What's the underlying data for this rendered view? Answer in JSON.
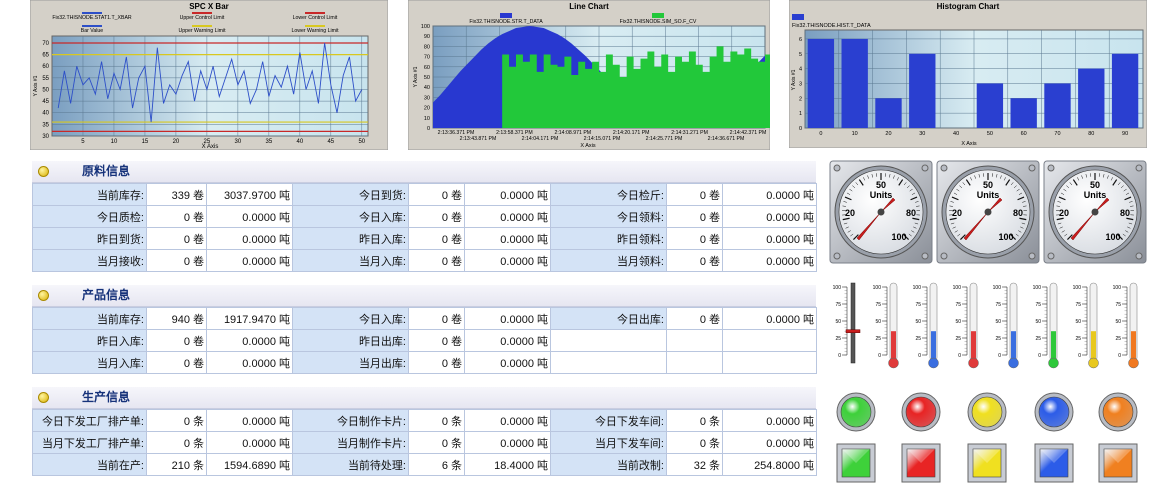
{
  "spc_chart": {
    "title": "SPC X Bar",
    "legend": [
      {
        "label": "Fix32.THISNODE.STAT1.T_XBAR",
        "color": "#2d4fc8"
      },
      {
        "label": "Upper Control Limit",
        "color": "#c82828"
      },
      {
        "label": "Lower Control Limit",
        "color": "#c82828"
      },
      {
        "label": "Bar Value",
        "color": "#2d4fc8"
      },
      {
        "label": "Upper Warning Limit",
        "color": "#d8c820"
      },
      {
        "label": "Lower Warning Limit",
        "color": "#d8c820"
      }
    ],
    "ylabel": "Y Axis #1",
    "xlabel": "X Axis",
    "y_ticks": [
      "70",
      "65",
      "60",
      "55",
      "50",
      "45",
      "40",
      "35",
      "30"
    ],
    "x_ticks": [
      "5",
      "10",
      "15",
      "20",
      "25",
      "30",
      "35",
      "40",
      "45",
      "50"
    ]
  },
  "line_chart": {
    "title": "Line Chart",
    "legend": [
      {
        "label": "Fix32.THISNODE.STR.T_DATA",
        "color": "#2838d0"
      },
      {
        "label": "Fix32.THISNODE.SIM_SO.F_CV",
        "color": "#22c83a"
      }
    ],
    "ylabel": "Y Axis #1",
    "xlabel": "X Axis",
    "y_ticks": [
      "100",
      "90",
      "80",
      "70",
      "60",
      "50",
      "40",
      "30",
      "20",
      "10",
      "0"
    ],
    "x_ticks_top": [
      "2:13:36.371 PM",
      "2:13:58.371 PM",
      "2:14:08.971 PM",
      "2:14:20.171 PM",
      "2:14:31.271 PM",
      "2:14:42.371 PM"
    ],
    "x_ticks_bottom": [
      "2:13:43.871 PM",
      "2:14:04.171 PM",
      "2:14:15.071 PM",
      "2:14:25.771 PM",
      "2:14:36.671 PM"
    ]
  },
  "histogram_chart": {
    "title": "Histogram Chart",
    "legend": [
      {
        "label": "Fix32.THISNODE.HIST.T_DATA",
        "color": "#2a3fd0"
      }
    ],
    "ylabel": "Y Axis #1",
    "xlabel": "X Axis",
    "y_ticks": [
      "6",
      "5",
      "4",
      "3",
      "2",
      "1",
      "0"
    ],
    "x_ticks": [
      "0",
      "10",
      "20",
      "30",
      "40",
      "50",
      "60",
      "70",
      "80",
      "90"
    ]
  },
  "chart_data": [
    {
      "type": "line",
      "title": "SPC X Bar",
      "xlabel": "X Axis",
      "ylabel": "Y Axis #1",
      "xlim": [
        0,
        51
      ],
      "ylim": [
        30,
        73
      ],
      "reference_lines": {
        "upper_control": 70,
        "lower_control": 32,
        "upper_warning": 65,
        "lower_warning": 36
      },
      "series": [
        {
          "name": "Fix32.THISNODE.STAT1.T_XBAR",
          "x": [
            1,
            2,
            3,
            4,
            5,
            6,
            7,
            8,
            9,
            10,
            11,
            12,
            13,
            14,
            15,
            16,
            17,
            18,
            19,
            20,
            21,
            22,
            23,
            24,
            25,
            26,
            27,
            28,
            29,
            30,
            31,
            32,
            33,
            34,
            35,
            36,
            37,
            38,
            39,
            40,
            41,
            42,
            43,
            44,
            45,
            46,
            47,
            48,
            49,
            50
          ],
          "y": [
            42,
            58,
            44,
            60,
            52,
            55,
            48,
            62,
            46,
            57,
            50,
            64,
            42,
            55,
            60,
            36,
            68,
            44,
            52,
            48,
            56,
            62,
            45,
            58,
            50,
            60,
            47,
            55,
            63,
            52,
            58,
            44,
            50,
            62,
            47,
            56,
            51,
            60,
            48,
            66,
            50,
            58,
            44,
            70,
            52,
            40,
            56,
            64,
            45,
            50
          ]
        }
      ]
    },
    {
      "type": "area",
      "title": "Line Chart",
      "xlabel": "X Axis",
      "ylabel": "Y Axis #1",
      "ylim": [
        0,
        100
      ],
      "series": [
        {
          "name": "Fix32.THISNODE.STR.T_DATA",
          "x": [
            0,
            1,
            2,
            3,
            4,
            5,
            6,
            7,
            8,
            9,
            10,
            11,
            12,
            13,
            14,
            15,
            16,
            17,
            18,
            19,
            20,
            21,
            22,
            23,
            24,
            25,
            26,
            27,
            28,
            29,
            30,
            31,
            32,
            33,
            34,
            35,
            36,
            37,
            38,
            39,
            40,
            41,
            42,
            43,
            44,
            45,
            46,
            47,
            48
          ],
          "y": [
            25,
            32,
            40,
            48,
            56,
            63,
            70,
            77,
            83,
            88,
            92,
            95,
            98,
            99,
            100,
            99,
            98,
            95,
            92,
            88,
            83,
            77,
            71,
            64,
            57,
            50,
            43,
            36,
            29,
            23,
            17,
            12,
            8,
            5,
            3,
            2,
            3,
            5,
            8,
            12,
            17,
            23,
            29,
            36,
            43,
            50,
            57,
            64,
            71
          ]
        },
        {
          "name": "Fix32.THISNODE.SIM_SO.F_CV",
          "x": [
            10,
            11,
            12,
            13,
            14,
            15,
            16,
            17,
            18,
            19,
            20,
            21,
            22,
            23,
            24,
            25,
            26,
            27,
            28,
            29,
            30,
            31,
            32,
            33,
            34,
            35,
            36,
            37,
            38,
            39,
            40,
            41,
            42,
            43,
            44,
            45,
            46,
            47,
            48
          ],
          "y": [
            72,
            60,
            72,
            65,
            72,
            55,
            72,
            62,
            60,
            70,
            52,
            65,
            58,
            65,
            55,
            72,
            62,
            50,
            70,
            58,
            68,
            75,
            60,
            72,
            55,
            70,
            65,
            75,
            62,
            55,
            70,
            80,
            65,
            75,
            72,
            78,
            68,
            65,
            72
          ]
        }
      ]
    },
    {
      "type": "bar",
      "title": "Histogram Chart",
      "xlabel": "X Axis",
      "ylabel": "Y Axis #1",
      "ylim": [
        0,
        6.6
      ],
      "categories": [
        "0",
        "10",
        "20",
        "30",
        "40",
        "50",
        "60",
        "70",
        "80",
        "90"
      ],
      "series": [
        {
          "name": "Fix32.THISNODE.HIST.T_DATA",
          "values": [
            6,
            6,
            2,
            5,
            0,
            3,
            2,
            3,
            4,
            5
          ]
        }
      ]
    }
  ],
  "gauges": [
    {
      "value_label": "50",
      "units": "Units",
      "tick_left": "20",
      "tick_right": "80",
      "tick_bottom": "100"
    },
    {
      "value_label": "50",
      "units": "Units",
      "tick_left": "20",
      "tick_right": "80",
      "tick_bottom": "100"
    },
    {
      "value_label": "50",
      "units": "Units",
      "tick_left": "20",
      "tick_right": "80",
      "tick_bottom": "100"
    }
  ],
  "thermometers": {
    "ticks": [
      "100",
      "75",
      "50",
      "25",
      "0"
    ],
    "items": [
      {
        "kind": "slider",
        "level": 0.35,
        "color": "#c81e1e"
      },
      {
        "kind": "tube",
        "level": 0.35,
        "color": "#e03a3a"
      },
      {
        "kind": "tube",
        "level": 0.35,
        "color": "#3a6ee0"
      },
      {
        "kind": "tube",
        "level": 0.35,
        "color": "#e03a3a"
      },
      {
        "kind": "tube",
        "level": 0.35,
        "color": "#3a6ee0"
      },
      {
        "kind": "tube",
        "level": 0.35,
        "color": "#2ec83a"
      },
      {
        "kind": "tube",
        "level": 0.35,
        "color": "#e8c81e"
      },
      {
        "kind": "tube",
        "level": 0.35,
        "color": "#f07820"
      }
    ]
  },
  "lights": {
    "round": [
      "#3ed13a",
      "#e82424",
      "#f0e020",
      "#2c5ce8",
      "#f08020"
    ],
    "square": [
      "#3ed13a",
      "#e82424",
      "#f0e020",
      "#2c5ce8",
      "#f08020"
    ]
  },
  "raw_info": {
    "title": "原料信息",
    "rows": [
      [
        {
          "label": "当前库存:"
        },
        {
          "value": "339 卷"
        },
        {
          "value": "3037.9700 吨"
        },
        {
          "label": "今日到货:"
        },
        {
          "value": "0 卷"
        },
        {
          "value": "0.0000 吨"
        },
        {
          "label": "今日检斤:"
        },
        {
          "value": "0 卷"
        },
        {
          "value": "0.0000 吨"
        }
      ],
      [
        {
          "label": "今日质检:"
        },
        {
          "value": "0 卷"
        },
        {
          "value": "0.0000 吨"
        },
        {
          "label": "今日入库:"
        },
        {
          "value": "0 卷"
        },
        {
          "value": "0.0000 吨"
        },
        {
          "label": "今日领料:"
        },
        {
          "value": "0 卷"
        },
        {
          "value": "0.0000 吨"
        }
      ],
      [
        {
          "label": "昨日到货:"
        },
        {
          "value": "0 卷"
        },
        {
          "value": "0.0000 吨"
        },
        {
          "label": "昨日入库:"
        },
        {
          "value": "0 卷"
        },
        {
          "value": "0.0000 吨"
        },
        {
          "label": "昨日领料:"
        },
        {
          "value": "0 卷"
        },
        {
          "value": "0.0000 吨"
        }
      ],
      [
        {
          "label": "当月接收:"
        },
        {
          "value": "0 卷"
        },
        {
          "value": "0.0000 吨"
        },
        {
          "label": "当月入库:"
        },
        {
          "value": "0 卷"
        },
        {
          "value": "0.0000 吨"
        },
        {
          "label": "当月领料:"
        },
        {
          "value": "0 卷"
        },
        {
          "value": "0.0000 吨"
        }
      ]
    ]
  },
  "product_info": {
    "title": "产品信息",
    "rows": [
      [
        {
          "label": "当前库存:"
        },
        {
          "value": "940 卷"
        },
        {
          "value": "1917.9470 吨"
        },
        {
          "label": "今日入库:"
        },
        {
          "value": "0 卷"
        },
        {
          "value": "0.0000 吨"
        },
        {
          "label": "今日出库:"
        },
        {
          "value": "0 卷"
        },
        {
          "value": "0.0000 吨"
        }
      ],
      [
        {
          "label": "昨日入库:"
        },
        {
          "value": "0 卷"
        },
        {
          "value": "0.0000 吨"
        },
        {
          "label": "昨日出库:"
        },
        {
          "value": "0 卷"
        },
        {
          "value": "0.0000 吨"
        },
        {
          "label": ""
        },
        {
          "value": ""
        },
        {
          "value": ""
        }
      ],
      [
        {
          "label": "当月入库:"
        },
        {
          "value": "0 卷"
        },
        {
          "value": "0.0000 吨"
        },
        {
          "label": "当月出库:"
        },
        {
          "value": "0 卷"
        },
        {
          "value": "0.0000 吨"
        },
        {
          "label": ""
        },
        {
          "value": ""
        },
        {
          "value": ""
        }
      ]
    ]
  },
  "production_info": {
    "title": "生产信息",
    "rows": [
      [
        {
          "label": "今日下发工厂排产单:"
        },
        {
          "value": "0 条"
        },
        {
          "value": "0.0000 吨"
        },
        {
          "label": "今日制作卡片:"
        },
        {
          "value": "0 条"
        },
        {
          "value": "0.0000 吨"
        },
        {
          "label": "今日下发车间:"
        },
        {
          "value": "0 条"
        },
        {
          "value": "0.0000 吨"
        }
      ],
      [
        {
          "label": "当月下发工厂排产单:"
        },
        {
          "value": "0 条"
        },
        {
          "value": "0.0000 吨"
        },
        {
          "label": "当月制作卡片:"
        },
        {
          "value": "0 条"
        },
        {
          "value": "0.0000 吨"
        },
        {
          "label": "当月下发车间:"
        },
        {
          "value": "0 条"
        },
        {
          "value": "0.0000 吨"
        }
      ],
      [
        {
          "label": "当前在产:"
        },
        {
          "value": "210 条"
        },
        {
          "value": "1594.6890 吨"
        },
        {
          "label": "当前待处理:"
        },
        {
          "value": "6 条"
        },
        {
          "value": "18.4000 吨"
        },
        {
          "label": "当前改制:"
        },
        {
          "value": "32 条"
        },
        {
          "value": "254.8000 吨"
        }
      ]
    ]
  }
}
